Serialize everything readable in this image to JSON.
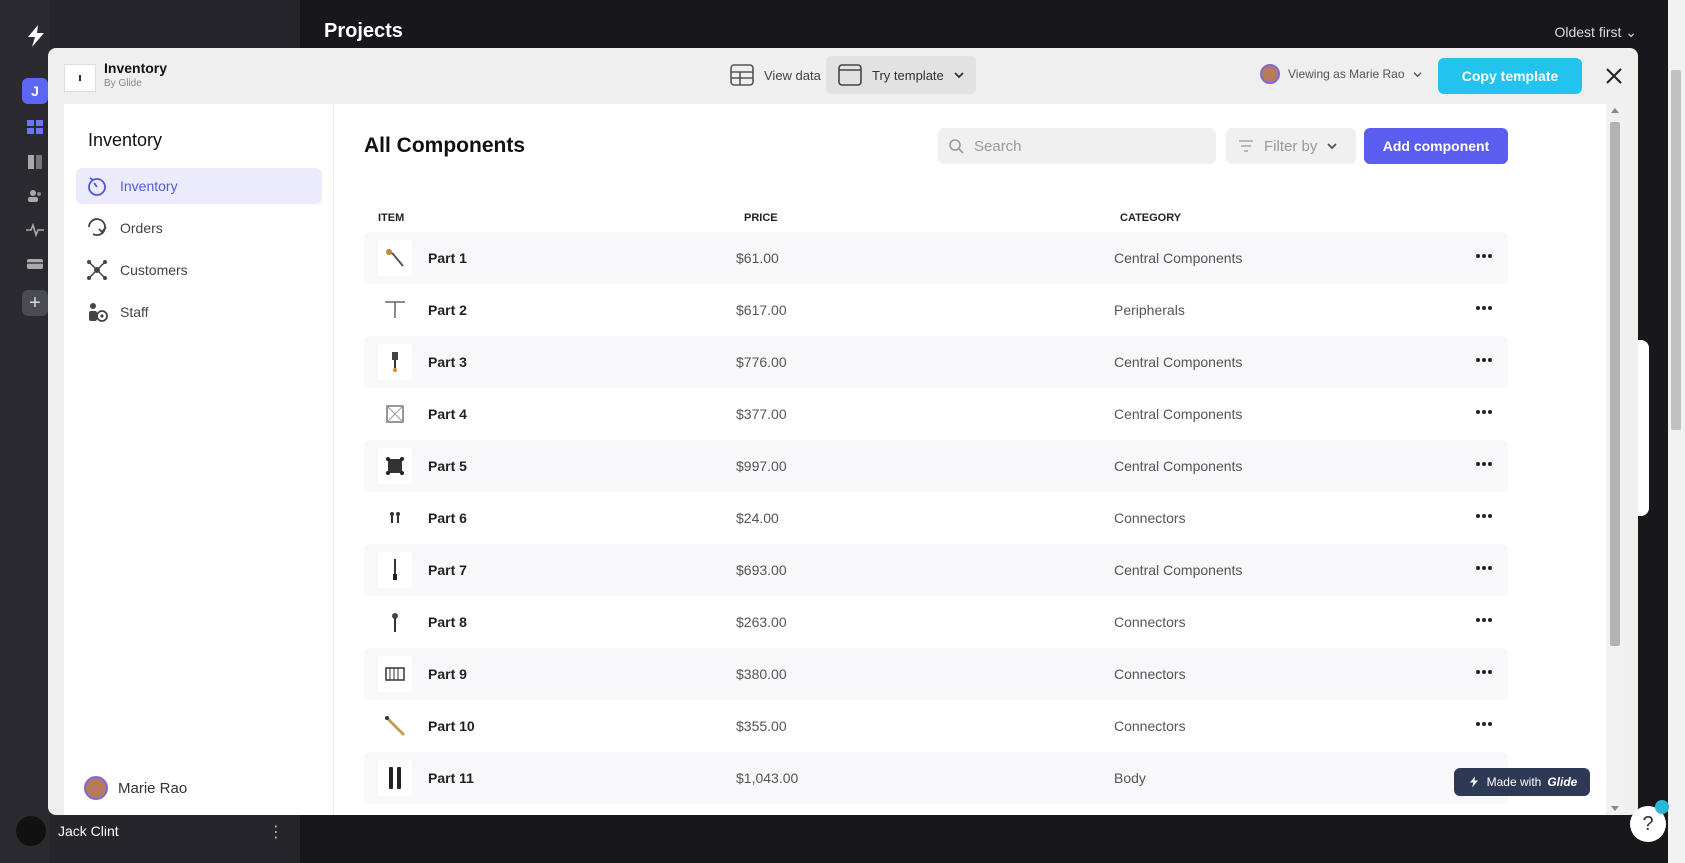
{
  "background": {
    "rail_avatar_letter": "J",
    "page_title": "Projects",
    "sort_label": "Oldest first",
    "user_name": "Jack Clint"
  },
  "modal": {
    "template_name": "Inventory",
    "template_by": "By Glide",
    "view_data_label": "View data",
    "try_template_label": "Try template",
    "viewing_as_label": "Viewing as Marie Rao",
    "copy_template_label": "Copy template"
  },
  "app": {
    "title": "Inventory",
    "nav": [
      {
        "label": "Inventory",
        "icon": "inventory-icon",
        "active": true
      },
      {
        "label": "Orders",
        "icon": "orders-icon",
        "active": false
      },
      {
        "label": "Customers",
        "icon": "customers-icon",
        "active": false
      },
      {
        "label": "Staff",
        "icon": "staff-icon",
        "active": false
      }
    ],
    "user_name": "Marie Rao",
    "content_title": "All Components",
    "search_placeholder": "Search",
    "filter_label": "Filter by",
    "add_label": "Add component",
    "columns": [
      "ITEM",
      "PRICE",
      "CATEGORY"
    ],
    "rows": [
      {
        "name": "Part 1",
        "price": "$61.00",
        "category": "Central Components"
      },
      {
        "name": "Part 2",
        "price": "$617.00",
        "category": "Peripherals"
      },
      {
        "name": "Part 3",
        "price": "$776.00",
        "category": "Central Components"
      },
      {
        "name": "Part 4",
        "price": "$377.00",
        "category": "Central Components"
      },
      {
        "name": "Part 5",
        "price": "$997.00",
        "category": "Central Components"
      },
      {
        "name": "Part 6",
        "price": "$24.00",
        "category": "Connectors"
      },
      {
        "name": "Part 7",
        "price": "$693.00",
        "category": "Central Components"
      },
      {
        "name": "Part 8",
        "price": "$263.00",
        "category": "Connectors"
      },
      {
        "name": "Part 9",
        "price": "$380.00",
        "category": "Connectors"
      },
      {
        "name": "Part 10",
        "price": "$355.00",
        "category": "Connectors"
      },
      {
        "name": "Part 11",
        "price": "$1,043.00",
        "category": "Body"
      }
    ],
    "made_with_prefix": "Made with",
    "made_with_brand": "Glide"
  },
  "colors": {
    "accent": "#5b5cf0",
    "copy_button": "#22c4ee",
    "active_nav_bg": "#ecebfd"
  }
}
